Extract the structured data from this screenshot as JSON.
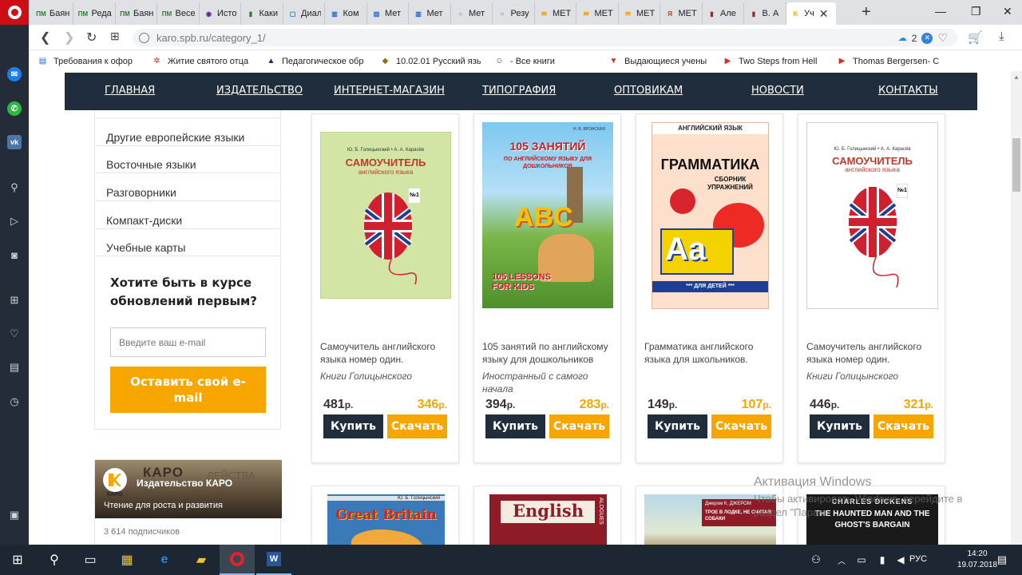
{
  "browser": {
    "tabs": [
      {
        "label": "Баян",
        "icon": "pm-icon",
        "fav": "ПМ",
        "color": "#2e7d32"
      },
      {
        "label": "Реда",
        "icon": "pm-icon",
        "fav": "ПМ",
        "color": "#2e7d32"
      },
      {
        "label": "Баян",
        "icon": "pm-icon",
        "fav": "ПМ",
        "color": "#2e7d32"
      },
      {
        "label": "Весе",
        "icon": "pm-icon",
        "fav": "ПМ",
        "color": "#2e7d32"
      },
      {
        "label": "Исто",
        "icon": "eye-icon",
        "fav": "◉",
        "color": "#6a1b9a"
      },
      {
        "label": "Каки",
        "icon": "book-icon",
        "fav": "▮",
        "color": "#2e7d32"
      },
      {
        "label": "Диал",
        "icon": "chat-icon",
        "fav": "▢",
        "color": "#1e66c8"
      },
      {
        "label": "Ком",
        "icon": "chart-icon",
        "fav": "▥",
        "color": "#1e66c8"
      },
      {
        "label": "Мет",
        "icon": "chart-icon",
        "fav": "▥",
        "color": "#1e66c8"
      },
      {
        "label": "Мет",
        "icon": "chart-icon",
        "fav": "▥",
        "color": "#1e66c8"
      },
      {
        "label": "Мет",
        "icon": "circle-icon",
        "fav": "○",
        "color": "#6f5bd0"
      },
      {
        "label": "Резу",
        "icon": "circle-icon",
        "fav": "○",
        "color": "#6f5bd0"
      },
      {
        "label": "МЕТ",
        "icon": "envelope-icon",
        "fav": "✉",
        "color": "#f29400"
      },
      {
        "label": "МЕТ",
        "icon": "envelope-icon",
        "fav": "✉",
        "color": "#f29400"
      },
      {
        "label": "МЕТ",
        "icon": "envelope-icon",
        "fav": "✉",
        "color": "#f29400"
      },
      {
        "label": "МЕТ",
        "icon": "yandex-icon",
        "fav": "Я",
        "color": "#e52620"
      },
      {
        "label": "Але",
        "icon": "book-icon",
        "fav": "▮",
        "color": "#8d2e2e"
      },
      {
        "label": "В. А",
        "icon": "book-icon",
        "fav": "▮",
        "color": "#8d2e2e"
      },
      {
        "label": "Уч",
        "icon": "karo-icon",
        "fav": "K",
        "color": "#f7a600",
        "active": true
      }
    ],
    "url": "karo.spb.ru/category_1/",
    "url_badge_count": "2",
    "bookmarks": [
      {
        "label": "Требования к офор",
        "icon": "book-icon",
        "mark": "▤",
        "color": "#1e66c8"
      },
      {
        "label": "Житие святого отца",
        "icon": "leaf-icon",
        "mark": "✲",
        "color": "#c0392b"
      },
      {
        "label": "Педагогическое обр",
        "icon": "building-icon",
        "mark": "▲",
        "color": "#1f2d6a"
      },
      {
        "label": "10.02.01 Русский язь",
        "icon": "shield-icon",
        "mark": "◆",
        "color": "#8a6d0c"
      },
      {
        "label": "- Все книги",
        "icon": "smiley-icon",
        "mark": "☺",
        "color": "#444444"
      },
      {
        "label": "Выдающиеся учены",
        "icon": "cap-icon",
        "mark": "▼",
        "color": "#c0392b"
      },
      {
        "label": "Two Steps from Hell",
        "icon": "youtube-icon",
        "mark": "▶",
        "color": "#e52620"
      },
      {
        "label": "Thomas Bergersen- C",
        "icon": "youtube-icon",
        "mark": "▶",
        "color": "#e52620"
      }
    ]
  },
  "site_nav": {
    "items": [
      "ГЛАВНАЯ",
      "ИЗДАТЕЛЬСТВО",
      "ИНТЕРНЕТ-МАГАЗИН",
      "ТИПОГРАФИЯ",
      "ОПТОВИКАМ",
      "НОВОСТИ",
      "КОНТАКТЫ"
    ]
  },
  "categories": [
    "Другие европейские языки",
    "Восточные языки",
    "Разговорники",
    "Компакт-диски",
    "Учебные карты"
  ],
  "subscribe": {
    "title": "Хотите быть в курсе обновлений первым?",
    "placeholder": "Введите ваш e-mail",
    "button": "Оставить свой e-mail"
  },
  "vk_widget": {
    "name": "Издательство КАРО",
    "slogan": "Чтение для роста и развития",
    "subscribers": "3 614 подписчиков",
    "brand": "КАРО",
    "brand_sub": "ДЕЙСТВА",
    "logo_text": "КАРО"
  },
  "products": [
    {
      "title": "Самоучитель английского языка номер один.",
      "author": "Книги Голицынского",
      "old_price": "481",
      "new_price": "346",
      "currency": "р.",
      "buy": "Купить",
      "download": "Скачать",
      "cover_title": "САМОУЧИТЕЛЬ",
      "cover_sub": "английского языка",
      "cover_authors": "Ю. Б. Голицынский • А. А. Карасёв",
      "cover_badge": "№1"
    },
    {
      "title": "105 занятий по английскому языку для дошкольников",
      "author": "Иностранный с самого начала",
      "old_price": "394",
      "new_price": "283",
      "currency": "р.",
      "buy": "Купить",
      "download": "Скачать",
      "cover_title": "105 ЗАНЯТИЙ",
      "cover_sub": "ПО АНГЛИЙСКОМУ ЯЗЫКУ ДЛЯ ДОШКОЛЬНИКОВ",
      "cover_authors": "Н. В. ВРОНСКАЯ",
      "cover_letters": "ABC",
      "cover_kids": "105 LESSONS FOR KIDS"
    },
    {
      "title": "Грамматика английского языка для школьников.",
      "author": "",
      "old_price": "149",
      "new_price": "107",
      "currency": "р.",
      "buy": "Купить",
      "download": "Скачать",
      "cover_header": "АНГЛИЙСКИЙ ЯЗЫК",
      "cover_title": "ГРАММАТИКА",
      "cover_sub": "СБОРНИК УПРАЖНЕНИЙ",
      "cover_letters": "Aa",
      "cover_footer": "*** ДЛЯ ДЕТЕЙ ***"
    },
    {
      "title": "Самоучитель английского языка номер один.",
      "author": "Книги Голицынского",
      "old_price": "446",
      "new_price": "321",
      "currency": "р.",
      "buy": "Купить",
      "download": "Скачать",
      "cover_title": "САМОУЧИТЕЛЬ",
      "cover_sub": "английского языка",
      "cover_authors": "Ю. Б. Голицынский • А. А. Карасёв",
      "cover_badge": "№1"
    }
  ],
  "products_row2": [
    {
      "cover_title": "Great Britain",
      "cover_authors": "Ю. Б. Голицынский"
    },
    {
      "cover_title": "English",
      "cover_sub": "ALOGUES"
    },
    {
      "cover_title": "ТРОЕ В ЛОДКЕ, НЕ СЧИТАЯ СОБАКИ",
      "cover_authors": "Джером К. ДЖЕРОМ"
    },
    {
      "cover_title": "THE HAUNTED MAN AND THE GHOST'S BARGAIN",
      "cover_authors": "CHARLES DICKENS"
    }
  ],
  "activation": {
    "title": "Активация Windows",
    "text": "Чтобы активировать Windows, перейдите в раздел \"Парам"
  },
  "taskbar": {
    "lang": "РУС",
    "time": "14:20",
    "date": "19.07.2018"
  },
  "colors": {
    "nav_bg": "#1f2d3d",
    "accent": "#f7a600",
    "opera_red": "#cc0f16",
    "taskbar": "#1c2733"
  }
}
